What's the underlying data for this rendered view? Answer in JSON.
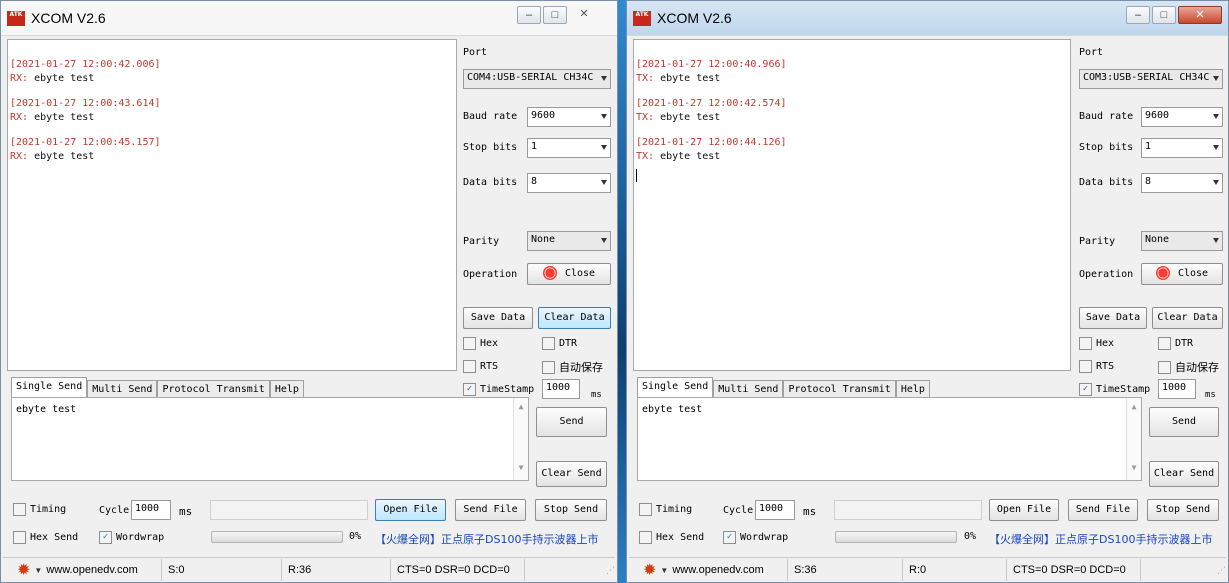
{
  "windows": [
    {
      "title": "XCOM V2.6",
      "logo_text": "ATK",
      "receive_entries": [
        {
          "timestamp": "[2021-01-27 12:00:42.006]",
          "prefix": "RX:",
          "text": " ebyte test"
        },
        {
          "timestamp": "[2021-01-27 12:00:43.614]",
          "prefix": "RX:",
          "text": " ebyte test"
        },
        {
          "timestamp": "[2021-01-27 12:00:45.157]",
          "prefix": "RX:",
          "text": " ebyte test"
        }
      ],
      "port_label": "Port",
      "port_value": "COM4:USB-SERIAL CH34C",
      "baud_label": "Baud rate",
      "baud_value": "9600",
      "stop_label": "Stop bits",
      "stop_value": "1",
      "data_label": "Data bits",
      "data_value": "8",
      "parity_label": "Parity",
      "parity_value": "None",
      "operation_label": "Operation",
      "operation_button": "Close",
      "save_data": "Save Data",
      "clear_data": "Clear Data",
      "hex_label": "Hex",
      "hex_checked": false,
      "dtr_label": "DTR",
      "dtr_checked": false,
      "rts_label": "RTS",
      "rts_checked": false,
      "autosave_label": "自动保存",
      "autosave_checked": false,
      "timestamp_label": "TimeStamp",
      "timestamp_checked": true,
      "timestamp_value": "1000",
      "timestamp_unit": "ms",
      "tabs": [
        "Single Send",
        "Multi Send",
        "Protocol Transmit",
        "Help"
      ],
      "active_tab": "Single Send",
      "send_text": "ebyte test",
      "send_button": "Send",
      "clear_send": "Clear Send",
      "timing_label": "Timing",
      "timing_checked": false,
      "cycle_label": "Cycle:",
      "cycle_value": "1000",
      "cycle_unit": "ms",
      "open_file": "Open File",
      "send_file": "Send File",
      "stop_send": "Stop Send",
      "hex_send_label": "Hex Send",
      "hex_send_checked": false,
      "wordwrap_label": "Wordwrap",
      "wordwrap_checked": true,
      "progress_percent": "0%",
      "ad_text": "【火爆全网】正点原子DS100手持示波器上市",
      "status_url": "www.openedv.com",
      "status_s": "S:0",
      "status_r": "R:36",
      "status_lines": "CTS=0 DSR=0 DCD=0"
    },
    {
      "title": "XCOM V2.6",
      "logo_text": "ATK",
      "receive_entries": [
        {
          "timestamp": "[2021-01-27 12:00:40.966]",
          "prefix": "TX:",
          "text": " ebyte test"
        },
        {
          "timestamp": "[2021-01-27 12:00:42.574]",
          "prefix": "TX:",
          "text": " ebyte test"
        },
        {
          "timestamp": "[2021-01-27 12:00:44.126]",
          "prefix": "TX:",
          "text": " ebyte test"
        }
      ],
      "port_label": "Port",
      "port_value": "COM3:USB-SERIAL CH34C",
      "baud_label": "Baud rate",
      "baud_value": "9600",
      "stop_label": "Stop bits",
      "stop_value": "1",
      "data_label": "Data bits",
      "data_value": "8",
      "parity_label": "Parity",
      "parity_value": "None",
      "operation_label": "Operation",
      "operation_button": "Close",
      "save_data": "Save Data",
      "clear_data": "Clear Data",
      "hex_label": "Hex",
      "hex_checked": false,
      "dtr_label": "DTR",
      "dtr_checked": false,
      "rts_label": "RTS",
      "rts_checked": false,
      "autosave_label": "自动保存",
      "autosave_checked": false,
      "timestamp_label": "TimeStamp",
      "timestamp_checked": true,
      "timestamp_value": "1000",
      "timestamp_unit": "ms",
      "tabs": [
        "Single Send",
        "Multi Send",
        "Protocol Transmit",
        "Help"
      ],
      "active_tab": "Single Send",
      "send_text": "ebyte test",
      "send_button": "Send",
      "clear_send": "Clear Send",
      "timing_label": "Timing",
      "timing_checked": false,
      "cycle_label": "Cycle:",
      "cycle_value": "1000",
      "cycle_unit": "ms",
      "open_file": "Open File",
      "send_file": "Send File",
      "stop_send": "Stop Send",
      "hex_send_label": "Hex Send",
      "hex_send_checked": false,
      "wordwrap_label": "Wordwrap",
      "wordwrap_checked": true,
      "progress_percent": "0%",
      "ad_text": "【火爆全网】正点原子DS100手持示波器上市",
      "status_url": "www.openedv.com",
      "status_s": "S:36",
      "status_r": "R:0",
      "status_lines": "CTS=0 DSR=0 DCD=0"
    }
  ],
  "colors": {
    "timestamp": "#c0392b",
    "ad_link": "#1845c4",
    "desktop": "#1d5f93"
  },
  "icons": {
    "settings": "gear-icon",
    "record": "record-icon"
  }
}
